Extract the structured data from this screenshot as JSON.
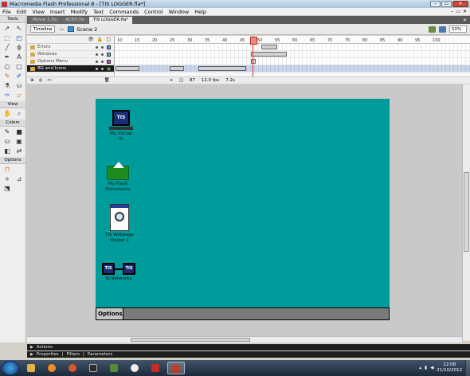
{
  "window": {
    "title": "Macromedia Flash Professional 8 - [TIS LOGGER.fla*]",
    "buttons": [
      "–",
      "▭",
      "✕"
    ]
  },
  "menu": [
    "File",
    "Edit",
    "View",
    "Insert",
    "Modify",
    "Text",
    "Commands",
    "Control",
    "Window",
    "Help"
  ],
  "menu_right": [
    "–",
    "▭",
    "✕"
  ],
  "tools_panel": {
    "header": "Tools",
    "view_header": "View",
    "colors_header": "Colors",
    "options_header": "Options"
  },
  "doc_tabs": [
    "Movie 1.fla",
    "ACEO.fla",
    "TIS LOGGER.fla*"
  ],
  "scenebar": {
    "timeline_button": "Timeline",
    "scene_label": "Scene 2",
    "zoom": "50%"
  },
  "timeline": {
    "layers": [
      {
        "name": "Errors",
        "selected": false
      },
      {
        "name": "Windows",
        "selected": false
      },
      {
        "name": "Options Menu",
        "selected": false
      },
      {
        "name": "BG and Icons",
        "selected": true
      }
    ],
    "ruler_ticks": [
      "10",
      "15",
      "20",
      "25",
      "30",
      "35",
      "40",
      "45",
      "50",
      "55",
      "60",
      "65",
      "70",
      "75",
      "80",
      "85",
      "90",
      "95",
      "100"
    ],
    "current_frame": "87",
    "fps": "12.0 fps",
    "elapsed": "7.2s"
  },
  "stage": {
    "background": "#009b9b",
    "icons": [
      {
        "label": "My Virtual IS",
        "glyph": "TIS"
      },
      {
        "label": "My Flash Documents",
        "glyph": ""
      },
      {
        "label": "TIS Webpage Viewer 1",
        "glyph": ""
      },
      {
        "label": "IS Networks",
        "glyph": "TIS"
      }
    ],
    "options_label": "Options"
  },
  "panels": [
    "Actions",
    "Properties",
    "Filters",
    "Parameters"
  ],
  "taskbar": {
    "time": "12:08",
    "date": "21/10/2012",
    "apps": [
      "explorer",
      "media",
      "firefox",
      "terminal",
      "minecraft",
      "chrome",
      "mario",
      "flash"
    ]
  },
  "accent_colors": {
    "stage": "#009b9b",
    "playhead": "#e0312b",
    "taskbar": "#1d2a3b"
  }
}
